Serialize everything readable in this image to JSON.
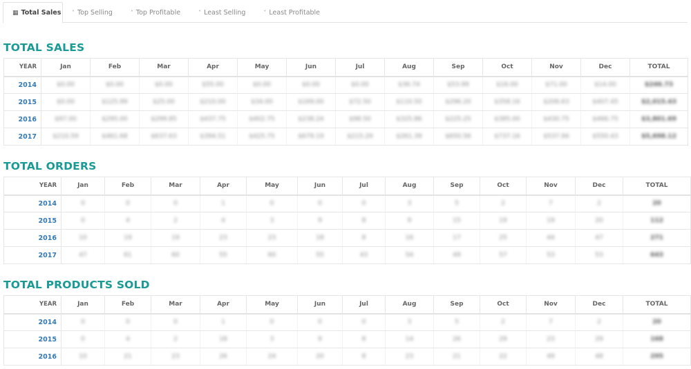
{
  "tabs": [
    {
      "label": "Total Sales",
      "icon": "table-icon",
      "glyph": "▦",
      "active": true
    },
    {
      "label": "Top Selling",
      "icon": "chevron-double-up-icon",
      "glyph": "«",
      "active": false
    },
    {
      "label": "Top Profitable",
      "icon": "chevron-double-up-icon",
      "glyph": "«",
      "active": false
    },
    {
      "label": "Least Selling",
      "icon": "chevron-double-down-icon",
      "glyph": "»",
      "active": false
    },
    {
      "label": "Least Profitable",
      "icon": "chevron-double-down-icon",
      "glyph": "»",
      "active": false
    }
  ],
  "colors": {
    "section_title": "#1a9a94",
    "year_link": "#337ab7"
  },
  "columns": [
    "YEAR",
    "Jan",
    "Feb",
    "Mar",
    "Apr",
    "May",
    "Jun",
    "Jul",
    "Aug",
    "Sep",
    "Oct",
    "Nov",
    "Dec",
    "TOTAL"
  ],
  "sections": [
    {
      "title": "TOTAL SALES",
      "rows": [
        {
          "year": "2014",
          "values": [
            "$0.00",
            "$0.00",
            "$0.00",
            "$55.00",
            "$0.00",
            "$0.00",
            "$0.00",
            "$36.74",
            "$53.99",
            "$16.00",
            "$71.00",
            "$14.00"
          ],
          "total": "$246.73"
        },
        {
          "year": "2015",
          "values": [
            "$0.00",
            "$125.99",
            "$25.00",
            "$210.00",
            "$34.00",
            "$169.00",
            "$72.50",
            "$110.50",
            "$296.20",
            "$358.16",
            "$206.63",
            "$407.45"
          ],
          "total": "$2,015.43"
        },
        {
          "year": "2016",
          "values": [
            "$97.00",
            "$295.00",
            "$299.85",
            "$437.75",
            "$402.75",
            "$238.24",
            "$98.50",
            "$325.86",
            "$225.25",
            "$385.00",
            "$430.75",
            "$466.75"
          ],
          "total": "$3,801.69"
        },
        {
          "year": "2017",
          "values": [
            "$210.59",
            "$461.68",
            "$637.63",
            "$394.51",
            "$425.75",
            "$679.19",
            "$215.29",
            "$261.39",
            "$650.56",
            "$737.16",
            "$537.94",
            "$550.43"
          ],
          "total": "$5,698.12"
        }
      ]
    },
    {
      "title": "TOTAL ORDERS",
      "rows": [
        {
          "year": "2014",
          "values": [
            "0",
            "0",
            "0",
            "1",
            "0",
            "0",
            "0",
            "3",
            "5",
            "2",
            "7",
            "2"
          ],
          "total": "20"
        },
        {
          "year": "2015",
          "values": [
            "0",
            "4",
            "2",
            "4",
            "3",
            "9",
            "8",
            "9",
            "15",
            "19",
            "19",
            "20"
          ],
          "total": "112"
        },
        {
          "year": "2016",
          "values": [
            "10",
            "19",
            "19",
            "23",
            "23",
            "18",
            "8",
            "16",
            "17",
            "25",
            "44",
            "47"
          ],
          "total": "271"
        },
        {
          "year": "2017",
          "values": [
            "47",
            "61",
            "60",
            "55",
            "60",
            "55",
            "43",
            "54",
            "49",
            "57",
            "53",
            "53"
          ],
          "total": "643"
        }
      ]
    },
    {
      "title": "TOTAL PRODUCTS SOLD",
      "rows": [
        {
          "year": "2014",
          "values": [
            "0",
            "0",
            "0",
            "1",
            "0",
            "0",
            "0",
            "3",
            "5",
            "2",
            "7",
            "2"
          ],
          "total": "20"
        },
        {
          "year": "2015",
          "values": [
            "0",
            "4",
            "2",
            "18",
            "3",
            "9",
            "8",
            "14",
            "26",
            "29",
            "23",
            "29"
          ],
          "total": "168"
        },
        {
          "year": "2016",
          "values": [
            "10",
            "21",
            "23",
            "26",
            "24",
            "20",
            "8",
            "23",
            "21",
            "22",
            "49",
            "48"
          ],
          "total": "295"
        }
      ]
    }
  ]
}
